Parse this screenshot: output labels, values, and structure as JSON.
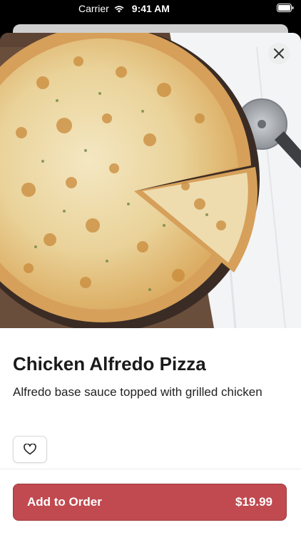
{
  "status_bar": {
    "carrier": "Carrier",
    "time": "9:41 AM"
  },
  "item": {
    "title": "Chicken Alfredo Pizza",
    "description": "Alfredo base sauce topped with grilled chicken",
    "image_icon": "pizza-photo"
  },
  "actions": {
    "close_icon": "close-icon",
    "favorite_icon": "heart-outline-icon",
    "add_label": "Add to Order",
    "price": "$19.99"
  },
  "colors": {
    "accent": "#c04a50",
    "background": "#ffffff",
    "text": "#1a1a1a"
  }
}
